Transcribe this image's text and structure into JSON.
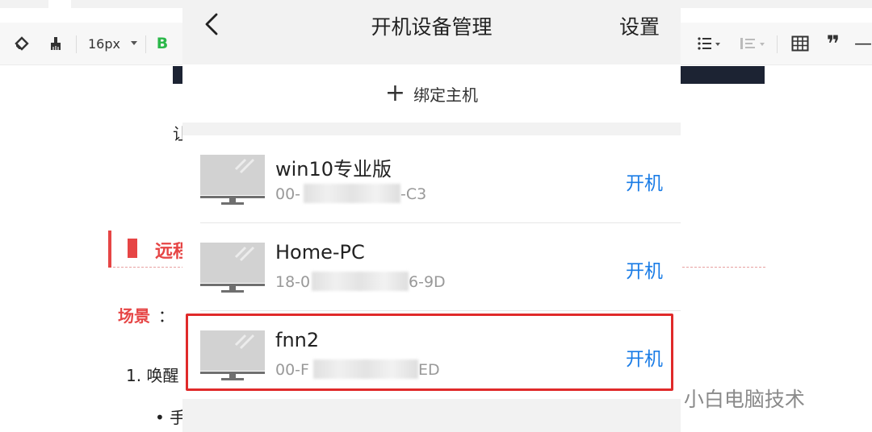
{
  "editor": {
    "toolbar": {
      "font_size": "16px",
      "bold_label": "B",
      "quote_glyph": "❞",
      "minus_glyph": "—"
    },
    "partial_char": "让",
    "section_title": "远程",
    "scene_label": "场景",
    "scene_colon": "：",
    "list_item_1": "1. 唤醒",
    "bullet_item": "• 手",
    "accent_color": "#e64545"
  },
  "watermark": {
    "text": "公众号 · 小白电脑技术"
  },
  "phone": {
    "title": "开机设备管理",
    "settings_label": "设置",
    "bind_plus": "+",
    "bind_label": "绑定主机",
    "devices": [
      {
        "name": "win10专业版",
        "mac_prefix": "00-",
        "mac_suffix": "-C3",
        "action": "开机"
      },
      {
        "name": "Home-PC",
        "mac_prefix": "18-0",
        "mac_suffix": "6-9D",
        "action": "开机"
      },
      {
        "name": "fnn2",
        "mac_prefix": "00-F",
        "mac_suffix": "ED",
        "action": "开机"
      }
    ],
    "highlighted_device": "fnn2",
    "action_color": "#1a7ce6",
    "highlight_color": "#e02a2a"
  }
}
